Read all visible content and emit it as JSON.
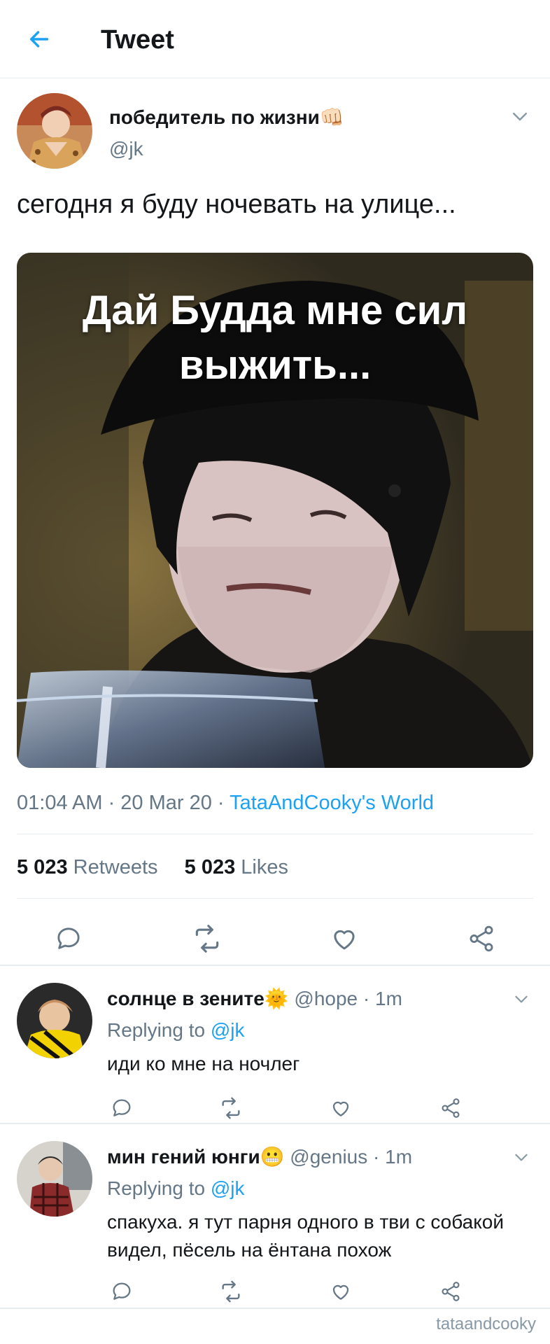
{
  "header": {
    "title": "Tweet",
    "back_icon": "arrow-left-icon",
    "accent": "#1da1f2"
  },
  "tweet": {
    "author_name": "победитель по жизни👊🏻",
    "author_handle": "@jk",
    "text": "сегодня я буду ночевать на улице...",
    "media_caption_line1": "Дай Будда мне сил",
    "media_caption_line2": "выжить...",
    "time": "01:04 AM · 20 Mar 20 · ",
    "source": "TataAndCooky's World",
    "retweets_count": "5 023",
    "retweets_label": " Retweets",
    "likes_count": "5 023",
    "likes_label": " Likes",
    "actions": [
      "reply-icon",
      "retweet-icon",
      "like-icon",
      "share-icon"
    ]
  },
  "replies": [
    {
      "name": "солнце в зените🌞",
      "meta": " @hope · 1m",
      "replying_prefix": "Replying to ",
      "replying_mention": "@jk",
      "text": "иди ко мне на ночлег"
    },
    {
      "name": "мин гений юнги😬",
      "meta": " @genius · 1m",
      "replying_prefix": "Replying to ",
      "replying_mention": "@jk",
      "text": "спакуха. я тут парня одного в тви с собакой видел, пёсель на ёнтана похож"
    }
  ],
  "watermark": "tataandcooky"
}
